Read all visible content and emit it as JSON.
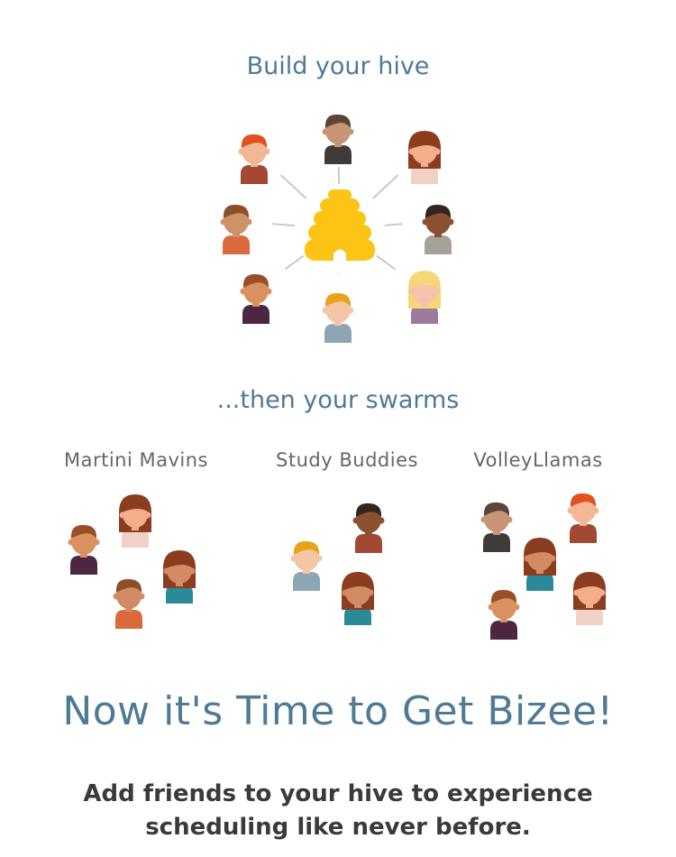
{
  "hive": {
    "title": "Build your hive",
    "hub_icon": "beehive-icon",
    "members": [
      {
        "icon": "person-icon",
        "skin": "#f2b795",
        "hair": "#e2521e",
        "hair_style": "short",
        "shirt": "#a24833"
      },
      {
        "icon": "person-icon",
        "skin": "#c79575",
        "hair": "#5b4439",
        "hair_style": "short",
        "shirt": "#3f3b38"
      },
      {
        "icon": "person-icon",
        "skin": "#f5ad8a",
        "hair": "#8c3d20",
        "hair_style": "long",
        "shirt": "#f0d1c6"
      },
      {
        "icon": "person-icon",
        "skin": "#ce9269",
        "hair": "#8b4f2a",
        "hair_style": "short",
        "shirt": "#da6a3d"
      },
      {
        "icon": "person-icon",
        "skin": "#8a5030",
        "hair": "#33251f",
        "hair_style": "short",
        "shirt": "#a7a19a"
      },
      {
        "icon": "person-icon",
        "skin": "#d9925f",
        "hair": "#9b4f26",
        "hair_style": "short",
        "shirt": "#4d2640"
      },
      {
        "icon": "person-icon",
        "skin": "#f5c6a4",
        "hair": "#e8a31a",
        "hair_style": "short",
        "shirt": "#8ea6b4"
      },
      {
        "icon": "person-icon",
        "skin": "#f5c2ad",
        "hair": "#f6d777",
        "hair_style": "long",
        "shirt": "#9b7a9c"
      }
    ]
  },
  "swarms": {
    "title": "...then your swarms",
    "groups": [
      {
        "name": "Martini Mavins",
        "members": [
          {
            "icon": "person-icon",
            "skin": "#d9925f",
            "hair": "#9b4f26",
            "hair_style": "short",
            "shirt": "#4d2640"
          },
          {
            "icon": "person-icon",
            "skin": "#f5ad8a",
            "hair": "#8c3d20",
            "hair_style": "long",
            "shirt": "#f0d1c6"
          },
          {
            "icon": "person-icon",
            "skin": "#d38b66",
            "hair": "#8b4f2a",
            "hair_style": "short",
            "shirt": "#da6a3d"
          },
          {
            "icon": "person-icon",
            "skin": "#d38b66",
            "hair": "#8c3d20",
            "hair_style": "long",
            "shirt": "#2b8a99"
          }
        ]
      },
      {
        "name": "Study Buddies",
        "members": [
          {
            "icon": "person-icon",
            "skin": "#f5c6a4",
            "hair": "#e8a31a",
            "hair_style": "short",
            "shirt": "#8ea6b4"
          },
          {
            "icon": "person-icon",
            "skin": "#8a5030",
            "hair": "#33251f",
            "hair_style": "short",
            "shirt": "#a24833"
          },
          {
            "icon": "person-icon",
            "skin": "#d38b66",
            "hair": "#8c3d20",
            "hair_style": "long",
            "shirt": "#2b8a99"
          }
        ]
      },
      {
        "name": "VolleyLlamas",
        "members": [
          {
            "icon": "person-icon",
            "skin": "#c79575",
            "hair": "#5b4439",
            "hair_style": "short",
            "shirt": "#3f3b38"
          },
          {
            "icon": "person-icon",
            "skin": "#f2b795",
            "hair": "#e2521e",
            "hair_style": "short",
            "shirt": "#a24833"
          },
          {
            "icon": "person-icon",
            "skin": "#d38b66",
            "hair": "#8c3d20",
            "hair_style": "long",
            "shirt": "#2b8a99"
          },
          {
            "icon": "person-icon",
            "skin": "#d9925f",
            "hair": "#9b4f26",
            "hair_style": "short",
            "shirt": "#4d2640"
          },
          {
            "icon": "person-icon",
            "skin": "#f5ad8a",
            "hair": "#8c3d20",
            "hair_style": "long",
            "shirt": "#f0d1c6"
          }
        ]
      }
    ]
  },
  "headline": "Now it's Time to Get Bizee!",
  "tagline": {
    "line1": "Add friends to your hive to experience",
    "line2": "scheduling like never before."
  },
  "colors": {
    "accent_blue": "#4e7a96",
    "hive_yellow": "#fdc315",
    "connector_gray": "#c9c9c9",
    "label_gray": "#666666",
    "body_text": "#3a3a3a"
  }
}
